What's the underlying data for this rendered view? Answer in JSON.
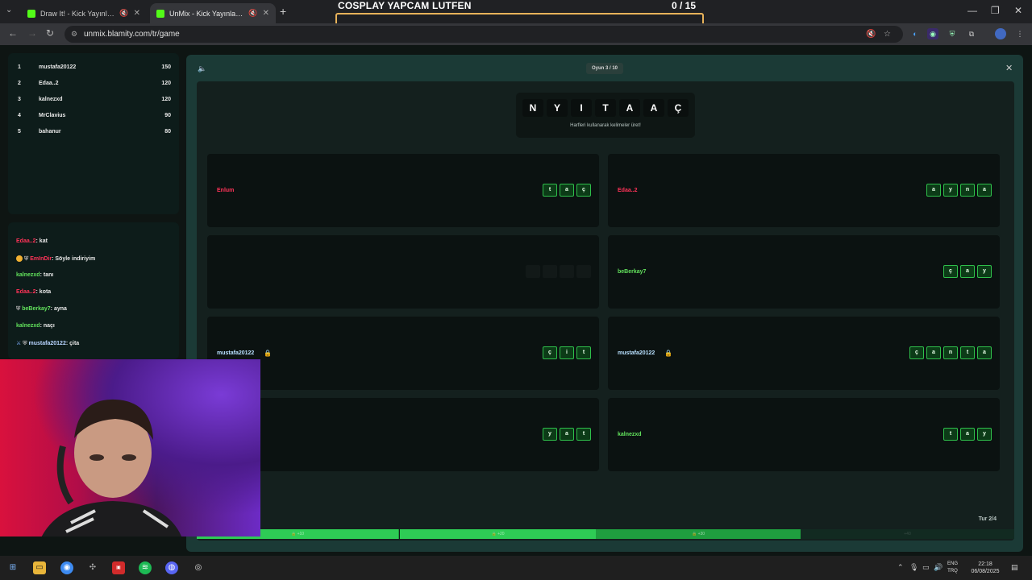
{
  "browser": {
    "tabs": [
      {
        "title": "Draw It! - Kick Yayınları İçin"
      },
      {
        "title": "UnMix - Kick Yayınları İçin"
      }
    ],
    "url": "unmix.blamity.com/tr/game"
  },
  "overlay": {
    "title": "COSPLAY YAPCAM LUTFEN",
    "count": "0 / 15"
  },
  "leaderboard": [
    {
      "rank": "1",
      "name": "mustafa20122",
      "points": "150"
    },
    {
      "rank": "2",
      "name": "Edaa..2",
      "points": "120"
    },
    {
      "rank": "3",
      "name": "kalnezxd",
      "points": "120"
    },
    {
      "rank": "4",
      "name": "MrClavius",
      "points": "90"
    },
    {
      "rank": "5",
      "name": "bahanur",
      "points": "80"
    }
  ],
  "chat": [
    {
      "user": "Edaa..2",
      "sep": ": ",
      "text": "kat",
      "color": "red"
    },
    {
      "user": "EmInDir",
      "sep": ": ",
      "text": "Söyle indiriyim",
      "color": "red"
    },
    {
      "user": "kalnezxd",
      "sep": ": ",
      "text": "tanı",
      "color": "green"
    },
    {
      "user": "Edaa..2",
      "sep": ": ",
      "text": "kota",
      "color": "red"
    },
    {
      "user": "beBerkay7",
      "sep": ": ",
      "text": "ayna",
      "color": "green"
    },
    {
      "user": "kalnezxd",
      "sep": ": ",
      "text": "naçı",
      "color": "green"
    },
    {
      "user": "mustafa20122",
      "sep": ": ",
      "text": "çita",
      "color": "blue"
    }
  ],
  "game": {
    "round_label": "Oyun 3 / 10",
    "letters": [
      "N",
      "Y",
      "I",
      "T",
      "A",
      "A",
      "Ç"
    ],
    "hint": "Harfleri kullanarak kelimeler üret!",
    "cards": [
      {
        "name": "Enlum",
        "color": "red",
        "locked": false,
        "tiles": [
          "t",
          "a",
          "ç"
        ]
      },
      {
        "name": "Edaa..2",
        "color": "red",
        "locked": false,
        "tiles": [
          "a",
          "y",
          "n",
          "a"
        ]
      },
      {
        "name": "",
        "color": "red",
        "locked": false,
        "tiles": [
          "",
          "",
          "",
          ""
        ]
      },
      {
        "name": "beBerkay7",
        "color": "green",
        "locked": false,
        "tiles": [
          "ç",
          "a",
          "y"
        ]
      },
      {
        "name": "mustafa20122",
        "color": "blue",
        "locked": true,
        "tiles": [
          "ç",
          "i",
          "t"
        ]
      },
      {
        "name": "mustafa20122",
        "color": "blue",
        "locked": true,
        "tiles": [
          "ç",
          "a",
          "n",
          "t",
          "a"
        ]
      },
      {
        "name": "",
        "color": "green",
        "locked": false,
        "tiles": [
          "y",
          "a",
          "t"
        ]
      },
      {
        "name": "kalnezxd",
        "color": "green",
        "locked": false,
        "tiles": [
          "t",
          "a",
          "y"
        ]
      }
    ],
    "tur_label": "Tur 2/4",
    "progress_segments": [
      "+10",
      "+20",
      "+30",
      "+40"
    ]
  },
  "taskbar": {
    "lang_top": "ENG",
    "lang_bottom": "TRQ",
    "time": "22:18",
    "date": "06/08/2025"
  },
  "colors": {
    "accent_green": "#2fbf4b",
    "panel": "#1b3a36",
    "name_red": "#ff3358",
    "name_green": "#63e35d"
  }
}
